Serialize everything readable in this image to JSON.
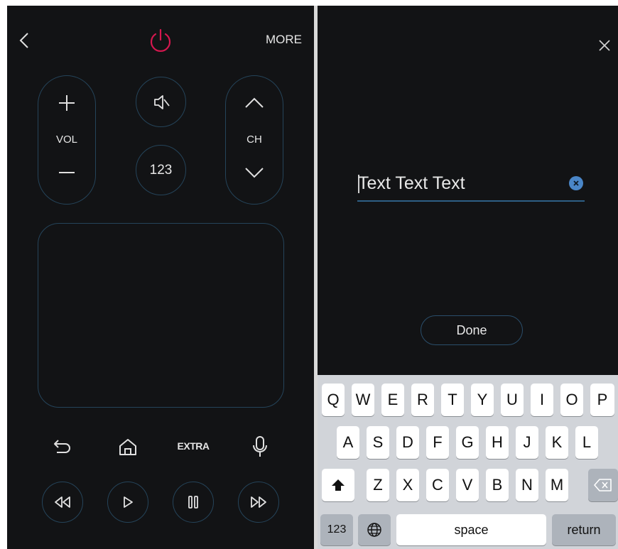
{
  "remote": {
    "more_label": "MORE",
    "vol_label": "VOL",
    "ch_label": "CH",
    "numpad_label": "123",
    "extra_label": "EXTRA",
    "power_color": "#d6174f",
    "icons": {
      "back": "chevron-left-icon",
      "power": "power-icon",
      "vol_up": "plus-icon",
      "vol_down": "minus-icon",
      "mute": "mute-icon",
      "ch_up": "chevron-up-icon",
      "ch_down": "chevron-down-icon",
      "return": "return-arrow-icon",
      "home": "home-icon",
      "mic": "microphone-icon",
      "rewind": "rewind-icon",
      "play": "play-icon",
      "pause": "pause-icon",
      "fast_forward": "fast-forward-icon"
    }
  },
  "text_entry": {
    "close_icon": "close-icon",
    "input_value": "Text Text Text",
    "clear_icon": "clear-circle-icon",
    "done_label": "Done",
    "accent_color": "#4a86c8"
  },
  "keyboard": {
    "row1": [
      "Q",
      "W",
      "E",
      "R",
      "T",
      "Y",
      "U",
      "I",
      "O",
      "P"
    ],
    "row2": [
      "A",
      "S",
      "D",
      "F",
      "G",
      "H",
      "J",
      "K",
      "L"
    ],
    "row3": [
      "Z",
      "X",
      "C",
      "V",
      "B",
      "N",
      "M"
    ],
    "shift_icon": "shift-arrow-icon",
    "backspace_icon": "backspace-icon",
    "numbers_label": "123",
    "globe_icon": "globe-icon",
    "space_label": "space",
    "return_label": "return"
  }
}
